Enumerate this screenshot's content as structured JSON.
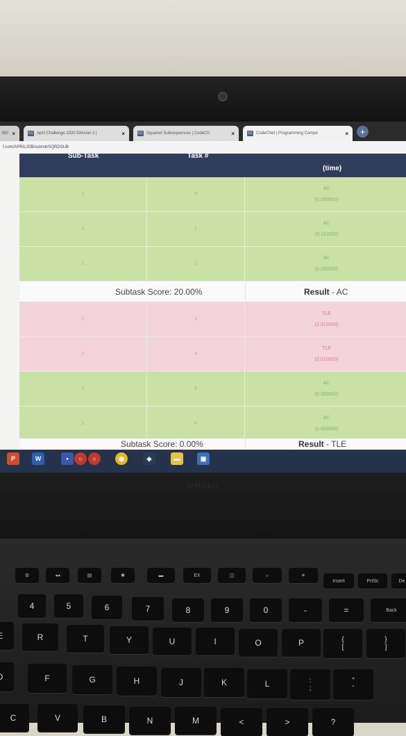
{
  "browser": {
    "tabs": [
      {
        "label": "April Challenge 2020 Division 2 |",
        "favicon": "CC"
      },
      {
        "label": "Squared Subsequences | CodeCh",
        "favicon": "CC"
      },
      {
        "label": "CodeChef | Programming Compe",
        "favicon": "CC"
      }
    ],
    "partial_tab_label": "360",
    "url": "f.com/APRIL20B/submit/SQRDSUB"
  },
  "table": {
    "headers": {
      "subtask": "Sub-Task",
      "task": "Task #",
      "result": "(time)"
    },
    "groups": [
      {
        "rows": [
          {
            "subtask": "1",
            "task": "0",
            "result": "AC",
            "time": "(0.090000)",
            "status": "green"
          },
          {
            "subtask": "1",
            "task": "1",
            "result": "AC",
            "time": "(0.110000)",
            "status": "green"
          },
          {
            "subtask": "1",
            "task": "2",
            "result": "AC",
            "time": "(0.200000)",
            "status": "green"
          }
        ],
        "score_label": "Subtask Score: 20.00%",
        "result_prefix": "Result",
        "result_value": "- AC"
      },
      {
        "rows": [
          {
            "subtask": "2",
            "task": "3",
            "result": "TLE",
            "time": "(2.010000)",
            "status": "red"
          },
          {
            "subtask": "2",
            "task": "4",
            "result": "TLE",
            "time": "(2.010000)",
            "status": "red"
          },
          {
            "subtask": "2",
            "task": "5",
            "result": "AC",
            "time": "(0.380000)",
            "status": "green"
          },
          {
            "subtask": "2",
            "task": "6",
            "result": "AC",
            "time": "(1.420000)",
            "status": "green"
          }
        ],
        "score_label": "Subtask Score: 0.00%",
        "result_prefix": "Result",
        "result_value": "- TLE"
      }
    ]
  },
  "laptop": {
    "brand": "lenovo"
  },
  "keyboard": {
    "fn_row": [
      "Insert",
      "PrtSc",
      "De"
    ],
    "fn_row_other": [
      "EX"
    ],
    "number_row": [
      "4",
      "5",
      "6",
      "7",
      "8",
      "9",
      "0",
      "-",
      "=",
      "Back"
    ],
    "number_row_symbols": [
      "$",
      "%",
      "^",
      "&",
      "*",
      "(",
      ")",
      "_",
      "+"
    ],
    "row_q": [
      "E",
      "R",
      "T",
      "Y",
      "U",
      "I",
      "O",
      "P",
      "{",
      "}"
    ],
    "row_q_lower": [
      "[",
      "]"
    ],
    "row_a": [
      "D",
      "F",
      "G",
      "H",
      "J",
      "K",
      "L",
      ":",
      "\""
    ],
    "row_a_lower": [
      ";",
      "'"
    ],
    "row_z": [
      "C",
      "V",
      "B",
      "N",
      "M",
      "<",
      ">",
      "?"
    ]
  },
  "colors": {
    "header": "#2f3c5c",
    "ac_row": "#c9e1a5",
    "tle_row": "#f3d4dc",
    "taskbar": "#24324a"
  }
}
